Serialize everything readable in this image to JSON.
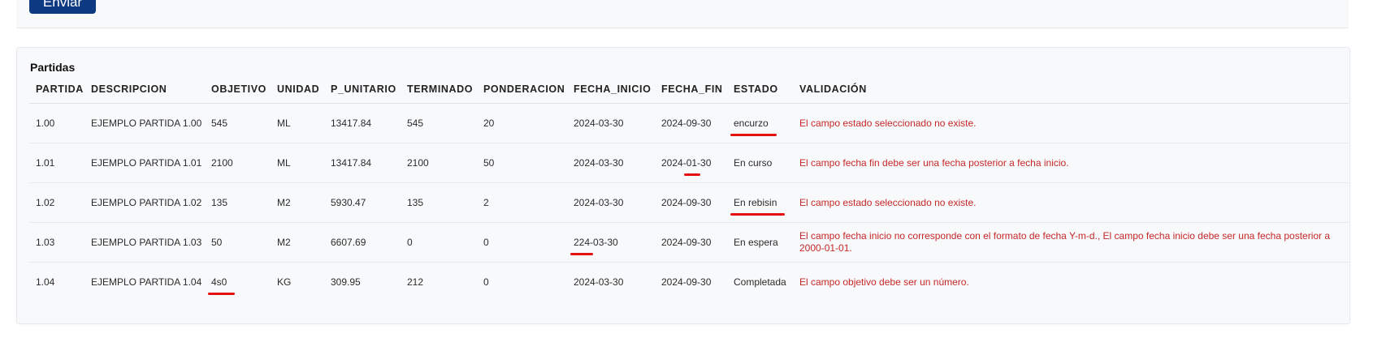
{
  "form": {
    "submit_label": "Enviar"
  },
  "section": {
    "title": "Partidas"
  },
  "table": {
    "headers": [
      "PARTIDA",
      "DESCRIPCION",
      "OBJETIVO",
      "UNIDAD",
      "P_UNITARIO",
      "TERMINADO",
      "PONDERACION",
      "FECHA_INICIO",
      "FECHA_FIN",
      "ESTADO",
      "VALIDACIÓN"
    ],
    "rows": [
      {
        "partida": "1.00",
        "descripcion": "EJEMPLO PARTIDA 1.00",
        "objetivo": "545",
        "unidad": "ML",
        "p_unitario": "13417.84",
        "terminado": "545",
        "ponderacion": "20",
        "fecha_inicio": "2024-03-30",
        "fecha_fin": "2024-09-30",
        "estado": "encurzo",
        "validacion": "El campo estado seleccionado no existe."
      },
      {
        "partida": "1.01",
        "descripcion": "EJEMPLO PARTIDA 1.01",
        "objetivo": "2100",
        "unidad": "ML",
        "p_unitario": "13417.84",
        "terminado": "2100",
        "ponderacion": "50",
        "fecha_inicio": "2024-03-30",
        "fecha_fin": "2024-01-30",
        "estado": "En curso",
        "validacion": "El campo fecha fin debe ser una fecha posterior a fecha inicio."
      },
      {
        "partida": "1.02",
        "descripcion": "EJEMPLO PARTIDA 1.02",
        "objetivo": "135",
        "unidad": "M2",
        "p_unitario": "5930.47",
        "terminado": "135",
        "ponderacion": "2",
        "fecha_inicio": "2024-03-30",
        "fecha_fin": "2024-09-30",
        "estado": "En rebisin",
        "validacion": "El campo estado seleccionado no existe."
      },
      {
        "partida": "1.03",
        "descripcion": "EJEMPLO PARTIDA 1.03",
        "objetivo": "50",
        "unidad": "M2",
        "p_unitario": "6607.69",
        "terminado": "0",
        "ponderacion": "0",
        "fecha_inicio": "224-03-30",
        "fecha_fin": "2024-09-30",
        "estado": "En espera",
        "validacion": "El campo fecha inicio no corresponde con el formato de fecha Y-m-d., El campo fecha inicio debe ser una fecha posterior a 2000-01-01."
      },
      {
        "partida": "1.04",
        "descripcion": "EJEMPLO PARTIDA 1.04",
        "objetivo": "4s0",
        "unidad": "KG",
        "p_unitario": "309.95",
        "terminado": "212",
        "ponderacion": "0",
        "fecha_inicio": "2024-03-30",
        "fecha_fin": "2024-09-30",
        "estado": "Completada",
        "validacion": "El campo objetivo debe ser un número."
      }
    ]
  },
  "colors": {
    "button_bg": "#0d3a80",
    "error_text": "#c62828",
    "highlight_underline": "#e31010",
    "card_bg": "#f8f9fb"
  }
}
